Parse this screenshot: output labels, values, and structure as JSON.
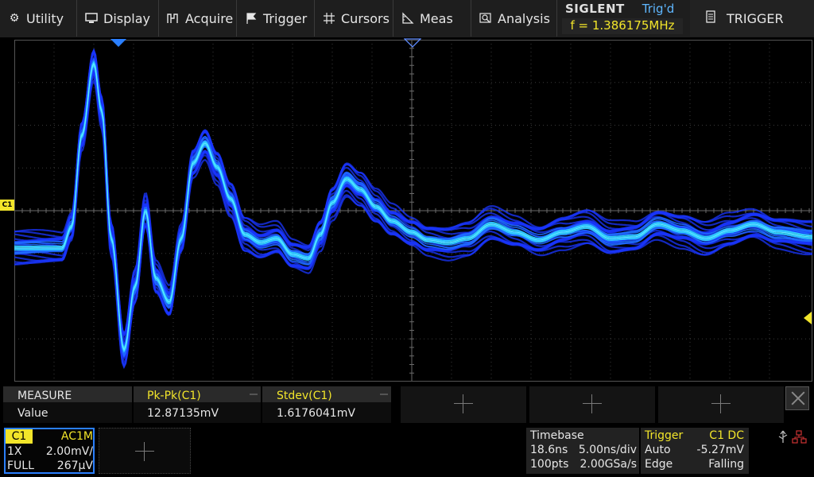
{
  "menu": {
    "items": [
      {
        "label": "Utility",
        "icon": "gear-icon"
      },
      {
        "label": "Display",
        "icon": "monitor-icon"
      },
      {
        "label": "Acquire",
        "icon": "acquire-icon"
      },
      {
        "label": "Trigger",
        "icon": "flag-icon"
      },
      {
        "label": "Cursors",
        "icon": "crosshair-icon"
      },
      {
        "label": "Meas",
        "icon": "ruler-icon"
      },
      {
        "label": "Analysis",
        "icon": "magnifier-icon"
      }
    ]
  },
  "brand": {
    "name": "SIGLENT",
    "trigger_state": "Trig'd",
    "frequency": "f = 1.386175MHz"
  },
  "right_menu": {
    "label": "TRIGGER",
    "icon": "list-icon"
  },
  "channel_marker": "C1",
  "measure": {
    "title": "MEASURE",
    "row_label": "Value",
    "columns": [
      {
        "name": "Pk-Pk(C1)",
        "value": "12.87135mV"
      },
      {
        "name": "Stdev(C1)",
        "value": "1.6176041mV"
      }
    ]
  },
  "channel": {
    "name": "C1",
    "coupling": "AC1M",
    "probe": "1X",
    "scale": "2.00mV/",
    "bandwidth": "FULL",
    "offset": "267μV"
  },
  "timebase": {
    "title": "Timebase",
    "delay": "18.6ns",
    "scale": "5.00ns/div",
    "points": "100pts",
    "sample_rate": "2.00GSa/s"
  },
  "trigger": {
    "title": "Trigger",
    "source": "C1 DC",
    "mode": "Auto",
    "level": "-5.27mV",
    "type": "Edge",
    "slope": "Falling"
  },
  "colors": {
    "ch1": "#f2e52a",
    "accent_blue": "#2a7fff",
    "trace_blue": "#1a35ff",
    "trace_cyan": "#33d8ff"
  }
}
